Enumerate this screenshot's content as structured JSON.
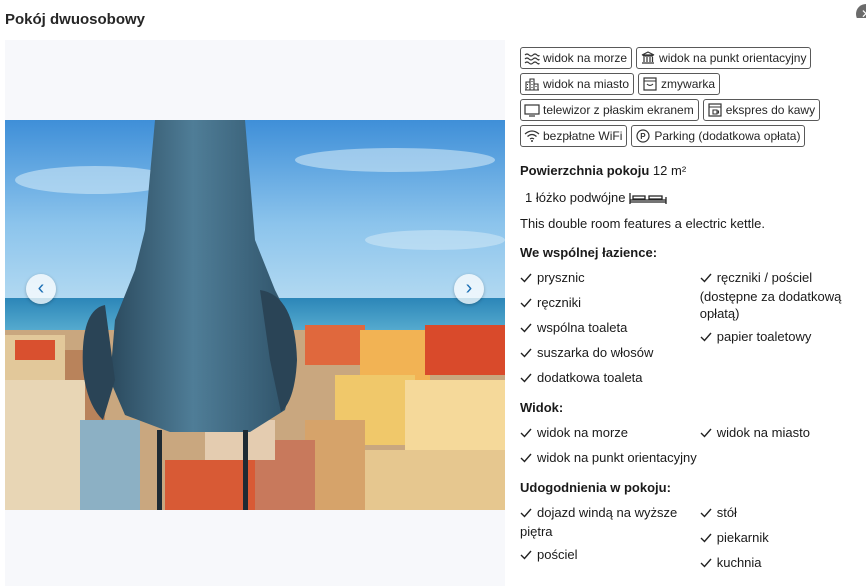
{
  "title": "Pokój dwuosobowy",
  "gallery": {
    "prev": "‹",
    "next": "›"
  },
  "facilities": [
    {
      "label": "widok na morze",
      "icon": "sea-view-icon"
    },
    {
      "label": "widok na punkt orientacyjny",
      "icon": "landmark-icon"
    },
    {
      "label": "widok na miasto",
      "icon": "city-view-icon"
    },
    {
      "label": "zmywarka",
      "icon": "dishwasher-icon"
    },
    {
      "label": "telewizor z płaskim ekranem",
      "icon": "tv-icon"
    },
    {
      "label": "ekspres do kawy",
      "icon": "coffee-machine-icon"
    },
    {
      "label": "bezpłatne WiFi",
      "icon": "wifi-icon"
    },
    {
      "label": "Parking (dodatkowa opłata)",
      "icon": "parking-icon"
    }
  ],
  "room": {
    "size_label": "Powierzchnia pokoju",
    "size_value": "12 m²",
    "bed": "1 łóżko podwójne",
    "description": "This double room features a electric kettle."
  },
  "bathroom": {
    "heading": "We wspólnej łazience:",
    "left": [
      "prysznic",
      "ręczniki",
      "wspólna toaleta",
      "suszarka do włosów",
      "dodatkowa toaleta"
    ],
    "right": [
      "ręczniki / pościel (dostępne za dodatkową opłatą)",
      "papier toaletowy"
    ]
  },
  "view": {
    "heading": "Widok:",
    "left": [
      "widok na morze",
      "widok na punkt orientacyjny"
    ],
    "right": [
      "widok na miasto"
    ]
  },
  "amenities": {
    "heading": "Udogodnienia w pokoju:",
    "left": [
      "dojazd windą na wyższe piętra",
      "pościel"
    ],
    "right": [
      "stół",
      "piekarnik",
      "kuchnia"
    ]
  }
}
